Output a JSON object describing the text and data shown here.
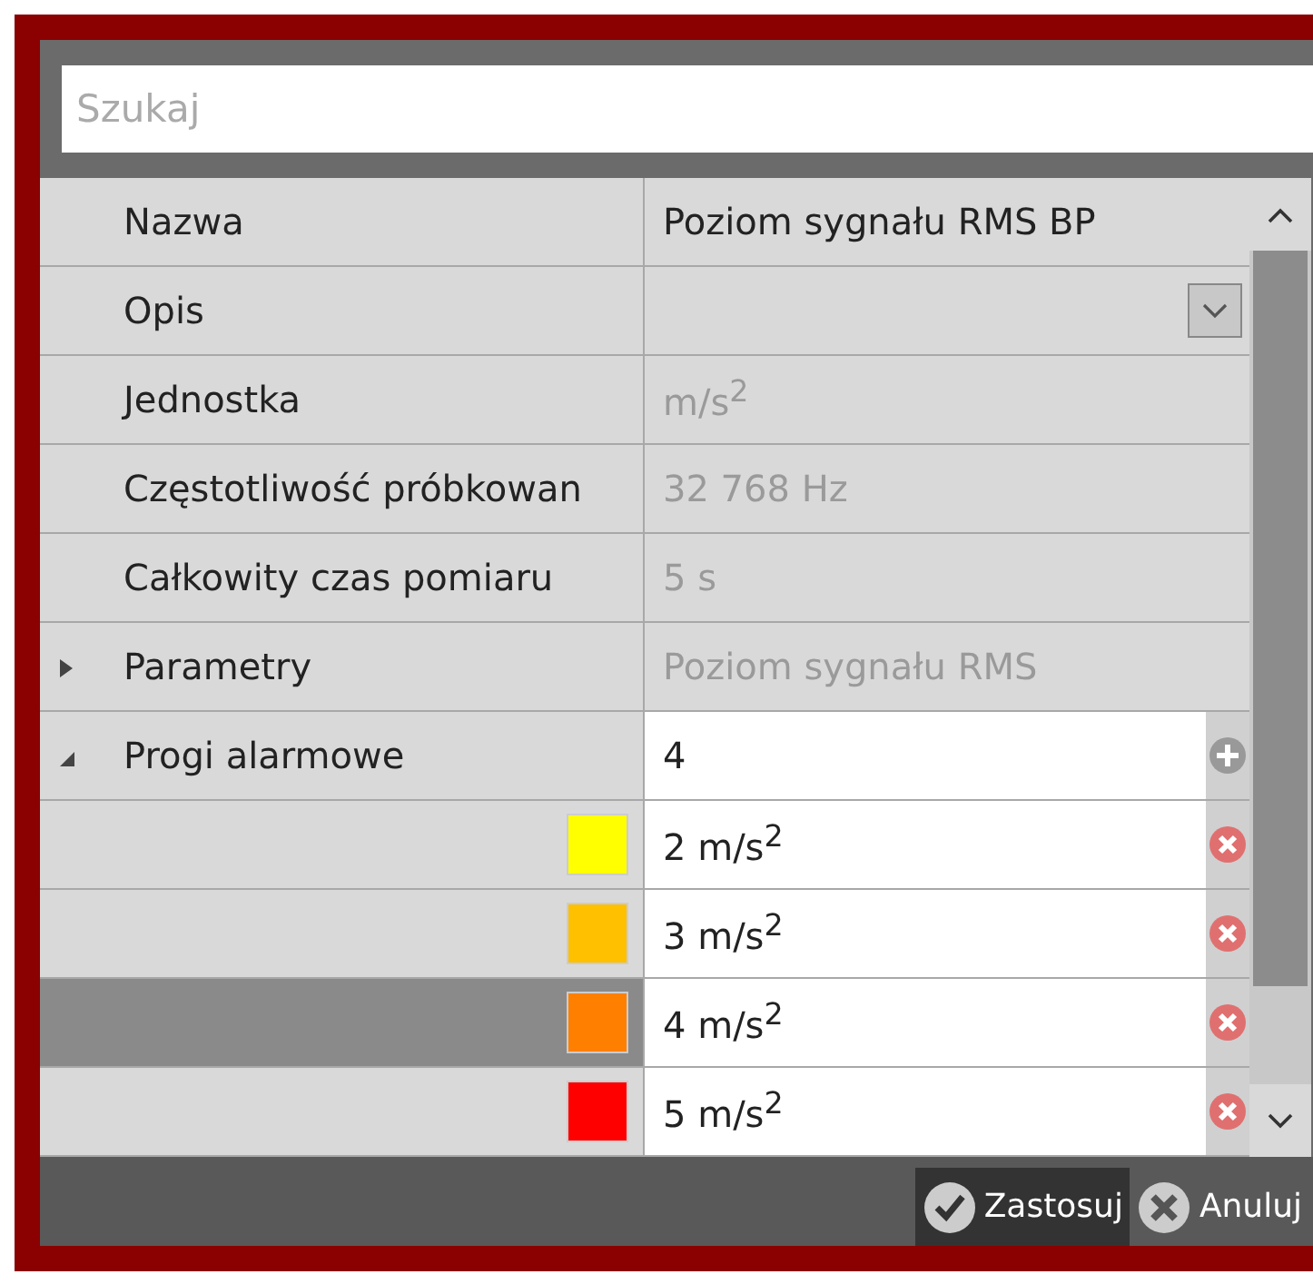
{
  "search": {
    "placeholder": "Szukaj"
  },
  "properties": [
    {
      "kind": "text",
      "name": "Nazwa",
      "value": "Poziom sygnału RMS BP",
      "readonly": false
    },
    {
      "kind": "dropdown",
      "name": "Opis"
    },
    {
      "kind": "text",
      "name": "Jednostka",
      "value": "m/s$^{2}$",
      "readonly": true
    },
    {
      "kind": "text",
      "name": "Częstotliwość próbkowan",
      "value": "32 768 Hz",
      "readonly": true
    },
    {
      "kind": "text",
      "name": "Całkowity czas pomiaru",
      "value": "5 s",
      "readonly": true
    },
    {
      "kind": "group",
      "name": "Parametry",
      "value": "Poziom sygnału RMS",
      "readonly": true,
      "expanded": false
    },
    {
      "kind": "group",
      "name": "Progi alarmowe",
      "value": "4",
      "readonly": false,
      "expanded": true
    }
  ],
  "thresholds": [
    {
      "color": "#ffff00",
      "value": "2 m/s$^{2}$",
      "selected": false
    },
    {
      "color": "#ffc000",
      "value": "3 m/s$^{2}$",
      "selected": false
    },
    {
      "color": "#ff8000",
      "value": "4 m/s$^{2}$",
      "selected": true
    },
    {
      "color": "#ff0000",
      "value": "5 m/s$^{2}$",
      "selected": false
    }
  ],
  "buttons": [
    {
      "label": "Zastosuj",
      "kind": "apply",
      "selected": true
    },
    {
      "label": "Anuluj",
      "kind": "cancel",
      "selected": false
    }
  ]
}
